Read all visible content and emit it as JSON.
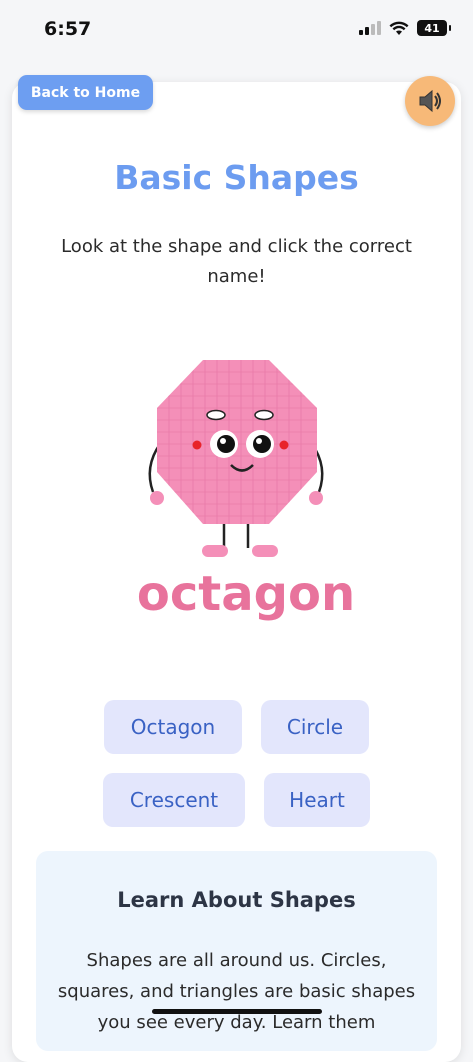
{
  "status_bar": {
    "time": "6:57",
    "battery_level": "41"
  },
  "header": {
    "back_label": "Back to Home",
    "sound_icon": "speaker-icon"
  },
  "main": {
    "title": "Basic Shapes",
    "instructions": "Look at the shape and click the correct name!",
    "illustration": {
      "caption": "octagon",
      "shape": "octagon",
      "color": "#f48fb8"
    },
    "answers": [
      {
        "label": "Octagon"
      },
      {
        "label": "Circle"
      },
      {
        "label": "Crescent"
      },
      {
        "label": "Heart"
      }
    ]
  },
  "learn": {
    "title": "Learn About Shapes",
    "text": "Shapes are all around us. Circles, squares, and triangles are basic shapes you see every day. Learn them"
  },
  "colors": {
    "title": "#6c9cf0",
    "back_button": "#6d9ef1",
    "sound_button": "#f7b978",
    "answer_bg": "#e3e6fc",
    "answer_text": "#3a62c4",
    "learn_bg": "#edf5fd"
  }
}
